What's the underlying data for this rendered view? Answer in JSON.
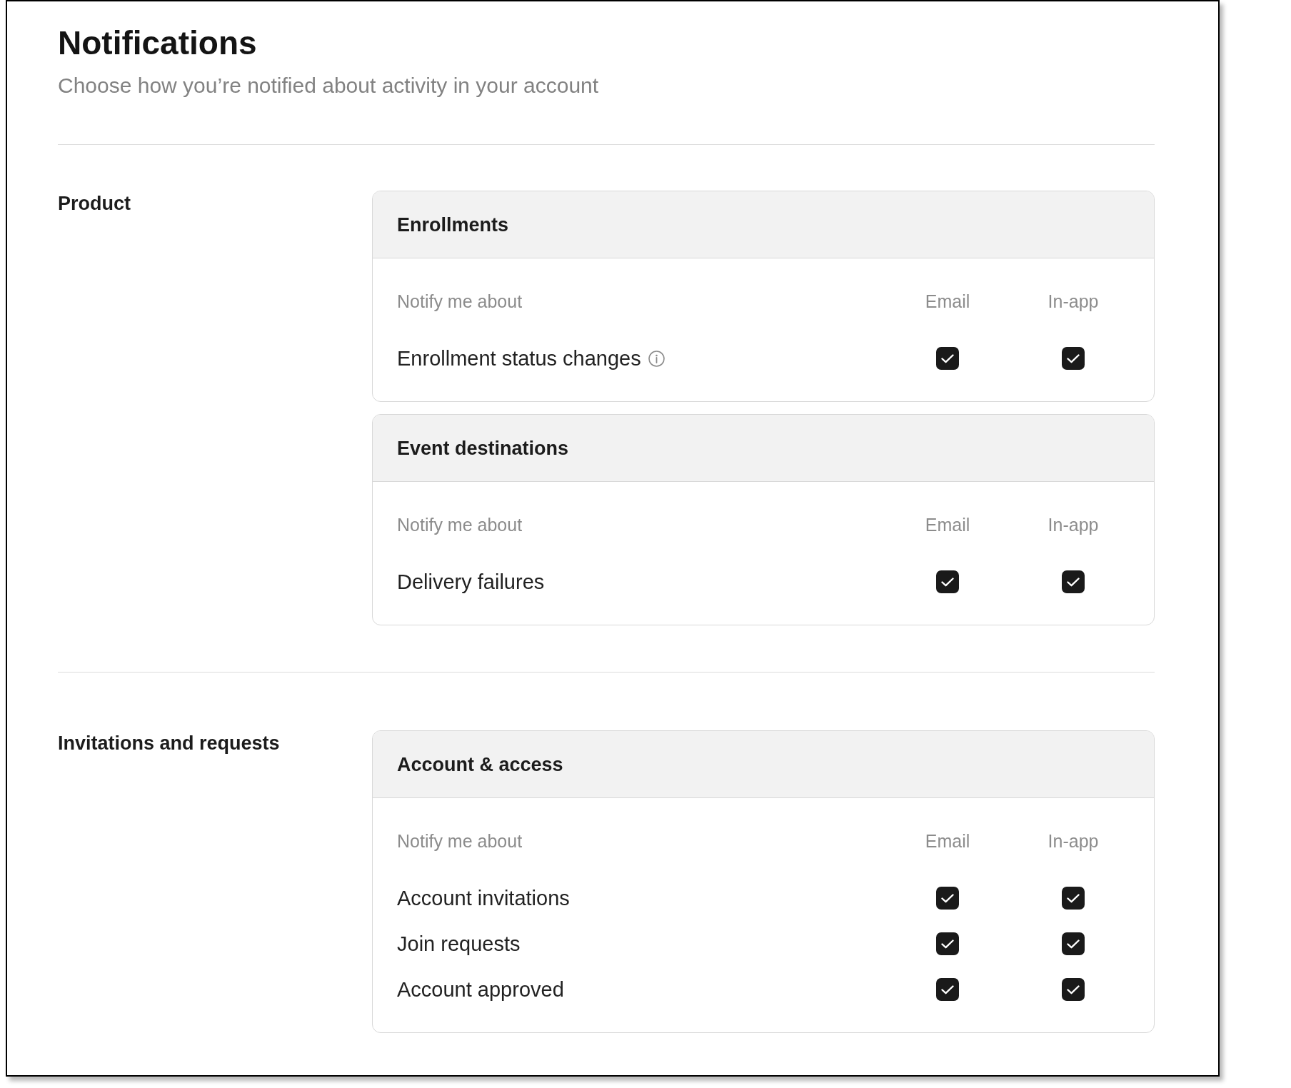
{
  "page": {
    "title": "Notifications",
    "subtitle": "Choose how you’re notified about activity in your account"
  },
  "sections": [
    {
      "label": "Product",
      "groups": [
        {
          "title": "Enrollments",
          "columns": [
            "Notify me about",
            "Email",
            "In-app"
          ],
          "rows": [
            {
              "label": "Enrollment status changes",
              "info": true,
              "channels": [
                {
                  "checked": true
                },
                {
                  "checked": true
                }
              ]
            }
          ]
        },
        {
          "title": "Event destinations",
          "columns": [
            "Notify me about",
            "Email",
            "In-app"
          ],
          "rows": [
            {
              "label": "Delivery failures",
              "info": false,
              "channels": [
                {
                  "checked": true
                },
                {
                  "checked": true
                }
              ]
            }
          ]
        }
      ]
    },
    {
      "label": "Invitations and requests",
      "groups": [
        {
          "title": "Account & access",
          "columns": [
            "Notify me about",
            "Email",
            "In-app"
          ],
          "rows": [
            {
              "label": "Account invitations",
              "info": false,
              "channels": [
                {
                  "checked": true
                },
                {
                  "checked": true
                }
              ]
            },
            {
              "label": "Join requests",
              "info": false,
              "channels": [
                {
                  "checked": true
                },
                {
                  "checked": true
                }
              ]
            },
            {
              "label": "Account approved",
              "info": false,
              "channels": [
                {
                  "checked": true
                },
                {
                  "checked": true
                }
              ]
            }
          ]
        }
      ]
    }
  ]
}
